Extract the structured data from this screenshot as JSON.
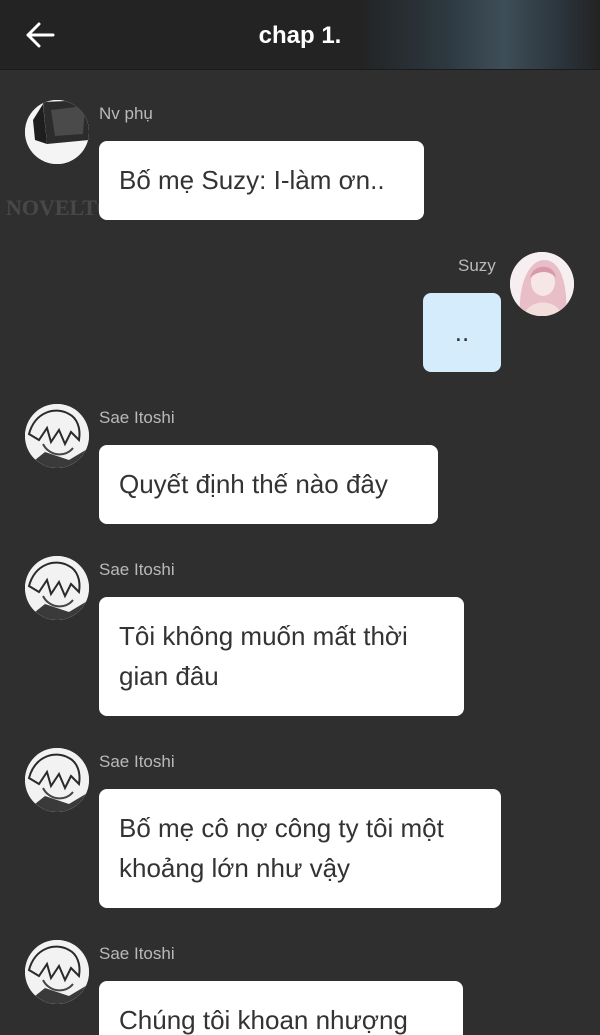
{
  "header": {
    "title": "chap 1."
  },
  "watermark": "NOVELTOON",
  "messages": [
    {
      "sender": "Nv phụ",
      "side": "left",
      "text": "Bố mẹ Suzy: I-làm ơn.."
    },
    {
      "sender": "Suzy",
      "side": "right",
      "text": ".."
    },
    {
      "sender": "Sae Itoshi",
      "side": "left",
      "text": "Quyết định thế nào đây"
    },
    {
      "sender": "Sae Itoshi",
      "side": "left",
      "text": "Tôi không muốn mất thời gian đâu"
    },
    {
      "sender": "Sae Itoshi",
      "side": "left",
      "text": "Bố mẹ cô nợ công ty tôi một khoảng lớn như vậy"
    },
    {
      "sender": "Sae Itoshi",
      "side": "left",
      "text": "Chúng tôi khoan nhượng"
    }
  ],
  "colors": {
    "background": "#2f2f2f",
    "header": "#232323",
    "bubble_left": "#ffffff",
    "bubble_right": "#d4ecfc",
    "sender_name": "#b9b9b9"
  },
  "icons": {
    "back": "arrow-left-icon"
  }
}
